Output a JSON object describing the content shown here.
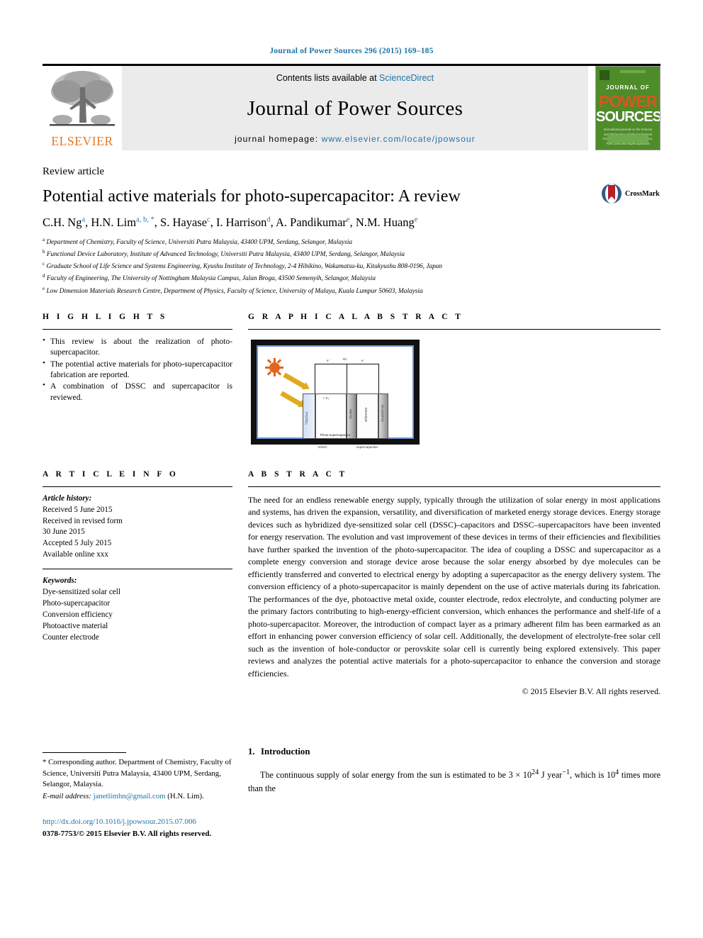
{
  "running_head": "Journal of Power Sources 296 (2015) 169–185",
  "masthead": {
    "contents_prefix": "Contents lists available at ",
    "contents_link": "ScienceDirect",
    "journal_name": "Journal of Power Sources",
    "homepage_prefix": "journal homepage: ",
    "homepage_url": "www.elsevier.com/locate/jpowsour",
    "publisher": "ELSEVIER",
    "cover": {
      "line1": "JOURNAL OF",
      "line2": "POWER",
      "line3": "SOURCES",
      "blurb": "International journal on the Science and Technology of Electrochemical Energy Systems including Batteries, Fuel Cells and Supercapacitors",
      "accent_green": "#4e8b29",
      "accent_orange": "#d4591f"
    }
  },
  "article": {
    "type": "Review article",
    "title": "Potential active materials for photo-supercapacitor: A review",
    "authors": [
      {
        "name": "C.H. Ng",
        "sup": "a"
      },
      {
        "name": "H.N. Lim",
        "sup": "a, b, *"
      },
      {
        "name": "S. Hayase",
        "sup": "c"
      },
      {
        "name": "I. Harrison",
        "sup": "d"
      },
      {
        "name": "A. Pandikumar",
        "sup": "e"
      },
      {
        "name": "N.M. Huang",
        "sup": "e"
      }
    ],
    "authors_line": "C.H. Ng a, H.N. Lim a, b, *, S. Hayase c, I. Harrison d, A. Pandikumar e, N.M. Huang e",
    "affiliations": [
      {
        "sup": "a",
        "text": "Department of Chemistry, Faculty of Science, Universiti Putra Malaysia, 43400 UPM, Serdang, Selangor, Malaysia"
      },
      {
        "sup": "b",
        "text": "Functional Device Laboratory, Institute of Advanced Technology, Universiti Putra Malaysia, 43400 UPM, Serdang, Selangor, Malaysia"
      },
      {
        "sup": "c",
        "text": "Graduate School of Life Science and Systems Engineering, Kyushu Institute of Technology, 2-4 Hibikino, Wakamatsu-ku, Kitakyushu 808-0196, Japan"
      },
      {
        "sup": "d",
        "text": "Faculty of Engineering, The University of Nottingham Malaysia Campus, Jalan Broga, 43500 Semenyih, Selangor, Malaysia"
      },
      {
        "sup": "e",
        "text": "Low Dimension Materials Research Centre, Department of Physics, Faculty of Science, University of Malaya, Kuala Lumpur 50603, Malaysia"
      }
    ],
    "crossmark_label": "CrossMark"
  },
  "highlights": {
    "heading": "H I G H L I G H T S",
    "items": [
      "This review is about the realization of photo-supercapacitor.",
      "The potential active materials for photo-supercapacitor fabrication are reported.",
      "A combination of DSSC and supercapacitor is reviewed."
    ]
  },
  "graphical_abstract": {
    "heading": "G R A P H I C A L   A B S T R A C T",
    "figure_caption": "Photo-supercapacitor",
    "labels": {
      "dssc": "DSSC",
      "supercapacitor": "supercapacitor",
      "electrode_1": "FTO/TiO₂",
      "electrode_2": "Pt/FTO",
      "electrode_3": "Pt-CNT/FTO",
      "electrolyte": "Electrolyte",
      "redox": "I⁻/I₃⁻",
      "load": "RL",
      "electron": "e⁻"
    }
  },
  "article_info": {
    "heading": "A R T I C L E   I N F O",
    "history_label": "Article history:",
    "history": [
      "Received 5 June 2015",
      "Received in revised form",
      "30 June 2015",
      "Accepted 5 July 2015",
      "Available online xxx"
    ],
    "keywords_label": "Keywords:",
    "keywords": [
      "Dye-sensitized solar cell",
      "Photo-supercapacitor",
      "Conversion efficiency",
      "Photoactive material",
      "Counter electrode"
    ]
  },
  "abstract": {
    "heading": "A B S T R A C T",
    "body": "The need for an endless renewable energy supply, typically through the utilization of solar energy in most applications and systems, has driven the expansion, versatility, and diversification of marketed energy storage devices. Energy storage devices such as hybridized dye-sensitized solar cell (DSSC)–capacitors and DSSC–supercapacitors have been invented for energy reservation. The evolution and vast improvement of these devices in terms of their efficiencies and flexibilities have further sparked the invention of the photo-supercapacitor. The idea of coupling a DSSC and supercapacitor as a complete energy conversion and storage device arose because the solar energy absorbed by dye molecules can be efficiently transferred and converted to electrical energy by adopting a supercapacitor as the energy delivery system. The conversion efficiency of a photo-supercapacitor is mainly dependent on the use of active materials during its fabrication. The performances of the dye, photoactive metal oxide, counter electrode, redox electrolyte, and conducting polymer are the primary factors contributing to high-energy-efficient conversion, which enhances the performance and shelf-life of a photo-supercapacitor. Moreover, the introduction of compact layer as a primary adherent film has been earmarked as an effort in enhancing power conversion efficiency of solar cell. Additionally, the development of electrolyte-free solar cell such as the invention of hole-conductor or perovskite solar cell is currently being explored extensively. This paper reviews and analyzes the potential active materials for a photo-supercapacitor to enhance the conversion and storage efficiencies.",
    "copyright": "© 2015 Elsevier B.V. All rights reserved."
  },
  "footer": {
    "corresponding_note": "* Corresponding author. Department of Chemistry, Faculty of Science, Universiti Putra Malaysia, 43400 UPM, Serdang, Selangor, Malaysia.",
    "email_label": "E-mail address:",
    "email": "janetlimhn@gmail.com",
    "email_owner": "(H.N. Lim).",
    "doi": "http://dx.doi.org/10.1016/j.jpowsour.2015.07.006",
    "issn_line": "0378-7753/© 2015 Elsevier B.V. All rights reserved."
  },
  "introduction": {
    "number": "1.",
    "heading": "Introduction",
    "paragraph_part1": "The continuous supply of solar energy from the sun is estimated to be 3 × 10",
    "exp1": "24",
    "paragraph_part2": " J year",
    "exp2": "−1",
    "paragraph_part3": ", which is 10",
    "exp3": "4",
    "paragraph_part4": " times more than the"
  }
}
